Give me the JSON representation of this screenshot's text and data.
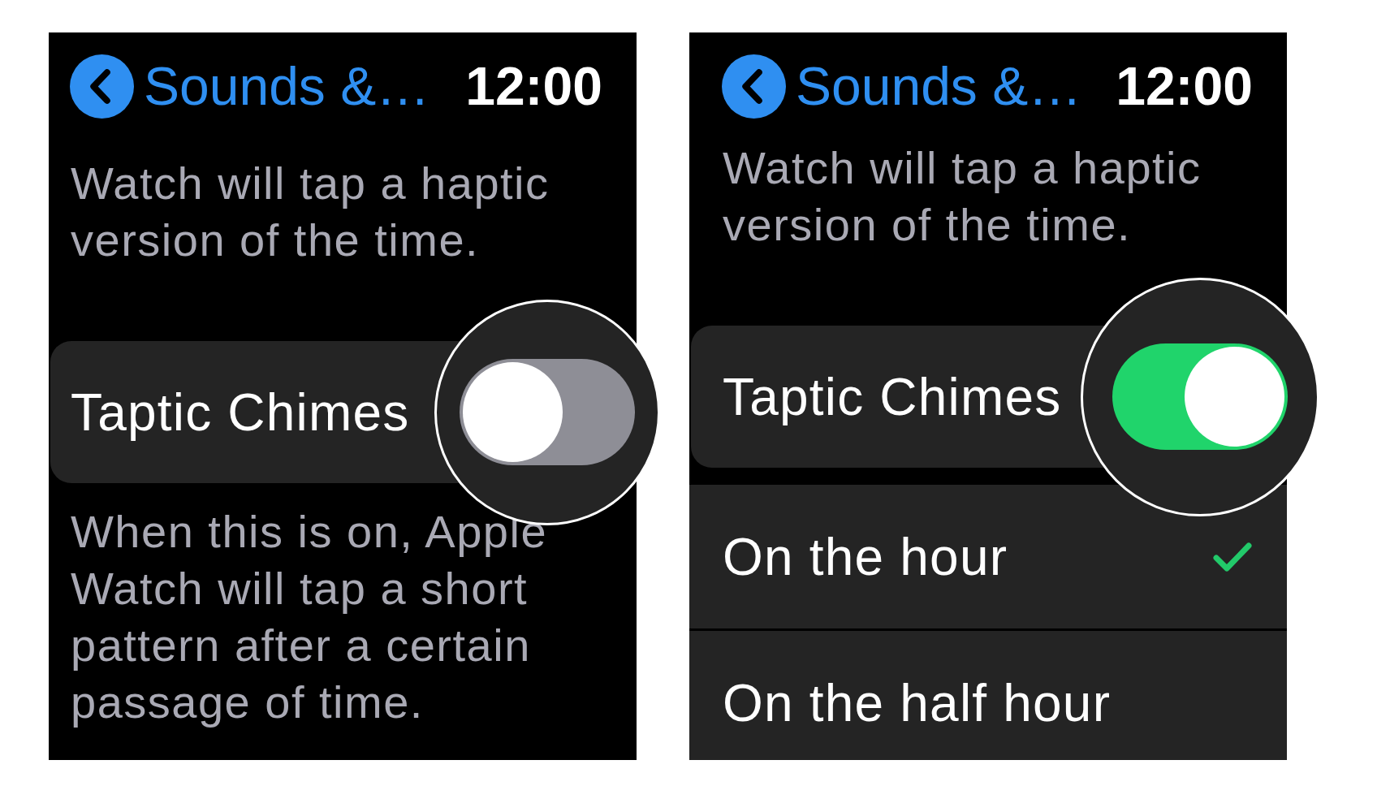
{
  "screens": [
    {
      "header": {
        "title": "Sounds &…",
        "time": "12:00"
      },
      "items": [
        {
          "kind": "footnote",
          "text": "Watch will tap a haptic version of the time."
        },
        {
          "kind": "toggle",
          "label": "Taptic Chimes",
          "on": false
        },
        {
          "kind": "footnote",
          "text": "When this is on, Apple Watch will tap a short pattern after a certain passage of time."
        }
      ]
    },
    {
      "header": {
        "title": "Sounds &…",
        "time": "12:00"
      },
      "items": [
        {
          "kind": "footnote",
          "text": "Watch will tap a haptic version of the time."
        },
        {
          "kind": "toggle",
          "label": "Taptic Chimes",
          "on": true
        },
        {
          "kind": "option",
          "label": "On the hour",
          "selected": true
        },
        {
          "kind": "option",
          "label": "On the half hour",
          "selected": false
        }
      ]
    }
  ]
}
